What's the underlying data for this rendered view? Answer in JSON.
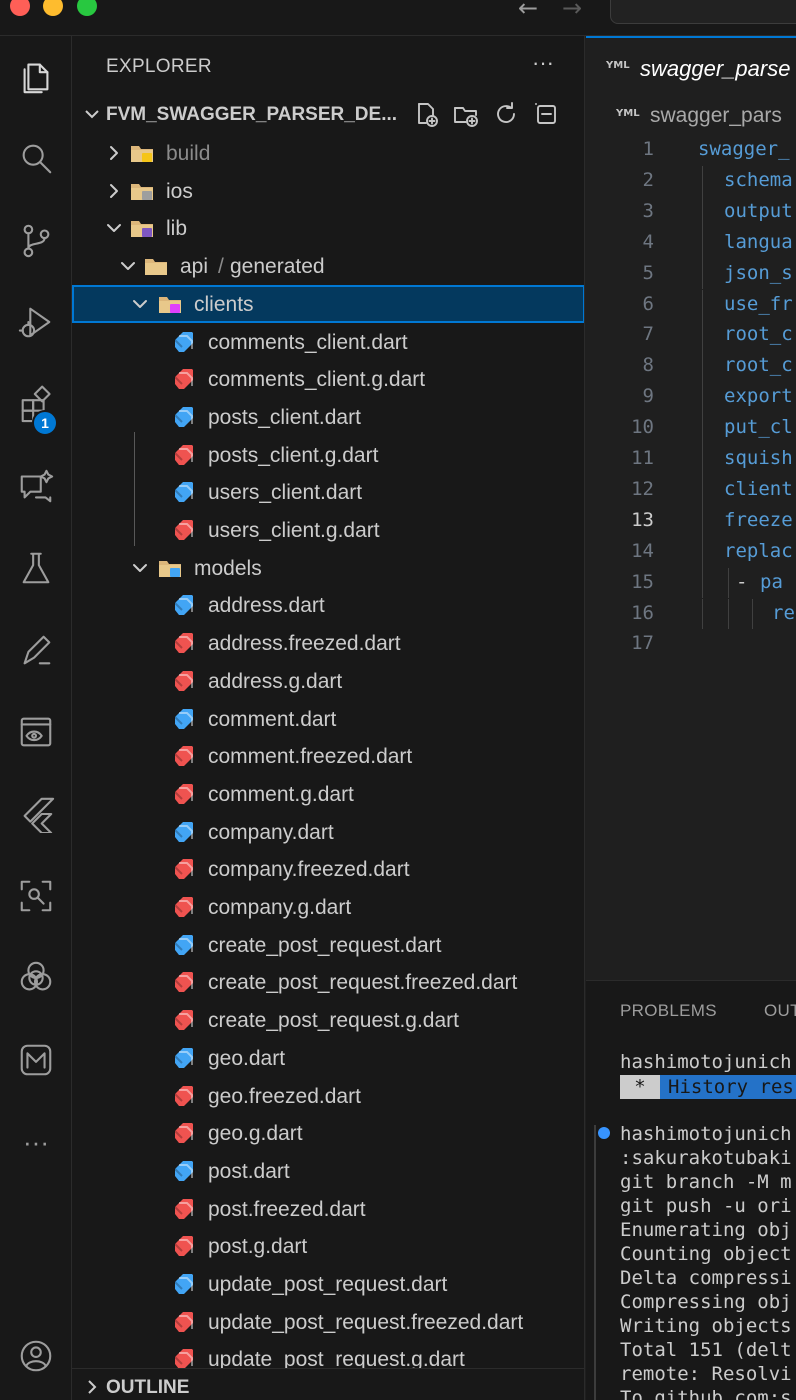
{
  "window": {
    "traffic_lights": [
      "#ff5f57",
      "#febc2e",
      "#28c840"
    ],
    "nav_back": "←",
    "nav_forward": "→"
  },
  "activity_bar": {
    "items": [
      {
        "name": "explorer-icon"
      },
      {
        "name": "search-icon"
      },
      {
        "name": "source-control-icon"
      },
      {
        "name": "run-debug-icon"
      },
      {
        "name": "extensions-icon",
        "badge": "1"
      },
      {
        "name": "chat-sparkle-icon"
      },
      {
        "name": "testing-flask-icon"
      },
      {
        "name": "pen-icon"
      },
      {
        "name": "preview-eye-icon"
      },
      {
        "name": "flutter-icon"
      },
      {
        "name": "scan-search-icon"
      },
      {
        "name": "openai-icon"
      },
      {
        "name": "m-logo-icon"
      },
      {
        "name": "more-icon"
      },
      {
        "name": "account-icon"
      }
    ],
    "more_label": "···"
  },
  "explorer": {
    "header": "EXPLORER",
    "more": "···",
    "project": "FVM_SWAGGER_PARSER_DE...",
    "outline_label": "OUTLINE",
    "tree": [
      {
        "label": "build",
        "type": "folder",
        "icon": "folder-build",
        "depth": 1,
        "expanded": false,
        "dim": true
      },
      {
        "label": "ios",
        "type": "folder",
        "icon": "folder-ios",
        "depth": 1,
        "expanded": false,
        "dim": false
      },
      {
        "label": "lib",
        "type": "folder",
        "icon": "folder-lib",
        "depth": 1,
        "expanded": true,
        "dim": false
      },
      {
        "label": "api",
        "label2": "generated",
        "type": "folder",
        "icon": "folder-plain",
        "depth": 2,
        "expanded": true,
        "dim": false
      },
      {
        "label": "clients",
        "type": "folder",
        "icon": "folder-clients",
        "depth": 3,
        "expanded": true,
        "selected": true
      },
      {
        "label": "comments_client.dart",
        "type": "file",
        "icon": "dart-blue",
        "depth": 4
      },
      {
        "label": "comments_client.g.dart",
        "type": "file",
        "icon": "dart-red",
        "depth": 4
      },
      {
        "label": "posts_client.dart",
        "type": "file",
        "icon": "dart-blue",
        "depth": 4
      },
      {
        "label": "posts_client.g.dart",
        "type": "file",
        "icon": "dart-red",
        "depth": 4
      },
      {
        "label": "users_client.dart",
        "type": "file",
        "icon": "dart-blue",
        "depth": 4
      },
      {
        "label": "users_client.g.dart",
        "type": "file",
        "icon": "dart-red",
        "depth": 4
      },
      {
        "label": "models",
        "type": "folder",
        "icon": "folder-models",
        "depth": 3,
        "expanded": true
      },
      {
        "label": "address.dart",
        "type": "file",
        "icon": "dart-blue",
        "depth": 4
      },
      {
        "label": "address.freezed.dart",
        "type": "file",
        "icon": "dart-red",
        "depth": 4
      },
      {
        "label": "address.g.dart",
        "type": "file",
        "icon": "dart-red",
        "depth": 4
      },
      {
        "label": "comment.dart",
        "type": "file",
        "icon": "dart-blue",
        "depth": 4
      },
      {
        "label": "comment.freezed.dart",
        "type": "file",
        "icon": "dart-red",
        "depth": 4
      },
      {
        "label": "comment.g.dart",
        "type": "file",
        "icon": "dart-red",
        "depth": 4
      },
      {
        "label": "company.dart",
        "type": "file",
        "icon": "dart-blue",
        "depth": 4
      },
      {
        "label": "company.freezed.dart",
        "type": "file",
        "icon": "dart-red",
        "depth": 4
      },
      {
        "label": "company.g.dart",
        "type": "file",
        "icon": "dart-red",
        "depth": 4
      },
      {
        "label": "create_post_request.dart",
        "type": "file",
        "icon": "dart-blue",
        "depth": 4
      },
      {
        "label": "create_post_request.freezed.dart",
        "type": "file",
        "icon": "dart-red",
        "depth": 4
      },
      {
        "label": "create_post_request.g.dart",
        "type": "file",
        "icon": "dart-red",
        "depth": 4
      },
      {
        "label": "geo.dart",
        "type": "file",
        "icon": "dart-blue",
        "depth": 4
      },
      {
        "label": "geo.freezed.dart",
        "type": "file",
        "icon": "dart-red",
        "depth": 4
      },
      {
        "label": "geo.g.dart",
        "type": "file",
        "icon": "dart-red",
        "depth": 4
      },
      {
        "label": "post.dart",
        "type": "file",
        "icon": "dart-blue",
        "depth": 4
      },
      {
        "label": "post.freezed.dart",
        "type": "file",
        "icon": "dart-red",
        "depth": 4
      },
      {
        "label": "post.g.dart",
        "type": "file",
        "icon": "dart-red",
        "depth": 4
      },
      {
        "label": "update_post_request.dart",
        "type": "file",
        "icon": "dart-blue",
        "depth": 4
      },
      {
        "label": "update_post_request.freezed.dart",
        "type": "file",
        "icon": "dart-red",
        "depth": 4
      },
      {
        "label": "update_post_request.g.dart",
        "type": "file",
        "icon": "dart-red",
        "depth": 4
      }
    ]
  },
  "editor": {
    "tab_icon": "YML",
    "tab_label": "swagger_parse",
    "breadcrumb_icon": "YML",
    "breadcrumb_label": "swagger_pars",
    "active_line": 13,
    "lines": [
      {
        "n": "1",
        "text": "swagger_",
        "indent": 0
      },
      {
        "n": "2",
        "text": "schema",
        "indent": 1
      },
      {
        "n": "3",
        "text": "output",
        "indent": 1
      },
      {
        "n": "4",
        "text": "langua",
        "indent": 1
      },
      {
        "n": "5",
        "text": "json_s",
        "indent": 1
      },
      {
        "n": "6",
        "text": "use_fr",
        "indent": 1
      },
      {
        "n": "7",
        "text": "root_c",
        "indent": 1
      },
      {
        "n": "8",
        "text": "root_c",
        "indent": 1
      },
      {
        "n": "9",
        "text": "export",
        "indent": 1
      },
      {
        "n": "10",
        "text": "put_cl",
        "indent": 1
      },
      {
        "n": "11",
        "text": "squish",
        "indent": 1
      },
      {
        "n": "12",
        "text": "client",
        "indent": 1
      },
      {
        "n": "13",
        "text": "freeze",
        "indent": 1
      },
      {
        "n": "14",
        "text": "replac",
        "indent": 1
      },
      {
        "n": "15",
        "dash": "- ",
        "text": "pa",
        "indent": 2
      },
      {
        "n": "16",
        "text": "re",
        "indent": 3
      },
      {
        "n": "17",
        "text": "",
        "indent": 0
      }
    ]
  },
  "panel": {
    "tabs": [
      "PROBLEMS",
      "OUT"
    ],
    "terminal": {
      "prompt_line": "hashimotojunich",
      "history_star": "*",
      "history_text": "History res",
      "lines": [
        "hashimotojunich",
        ":sakurakotubaki",
        "git branch -M m",
        "git push -u ori",
        "Enumerating obj",
        "Counting object",
        "Delta compressi",
        "Compressing obj",
        "Writing objects",
        "Total 151 (delt",
        "remote: Resolvi",
        "To github.com:s"
      ]
    }
  },
  "colors": {
    "accent": "#0078d4",
    "selection": "#04395e",
    "dart_blue": "#42a5f5",
    "dart_red": "#ef5350",
    "folder": "#dcb67a",
    "yaml_key": "#569cd6"
  }
}
